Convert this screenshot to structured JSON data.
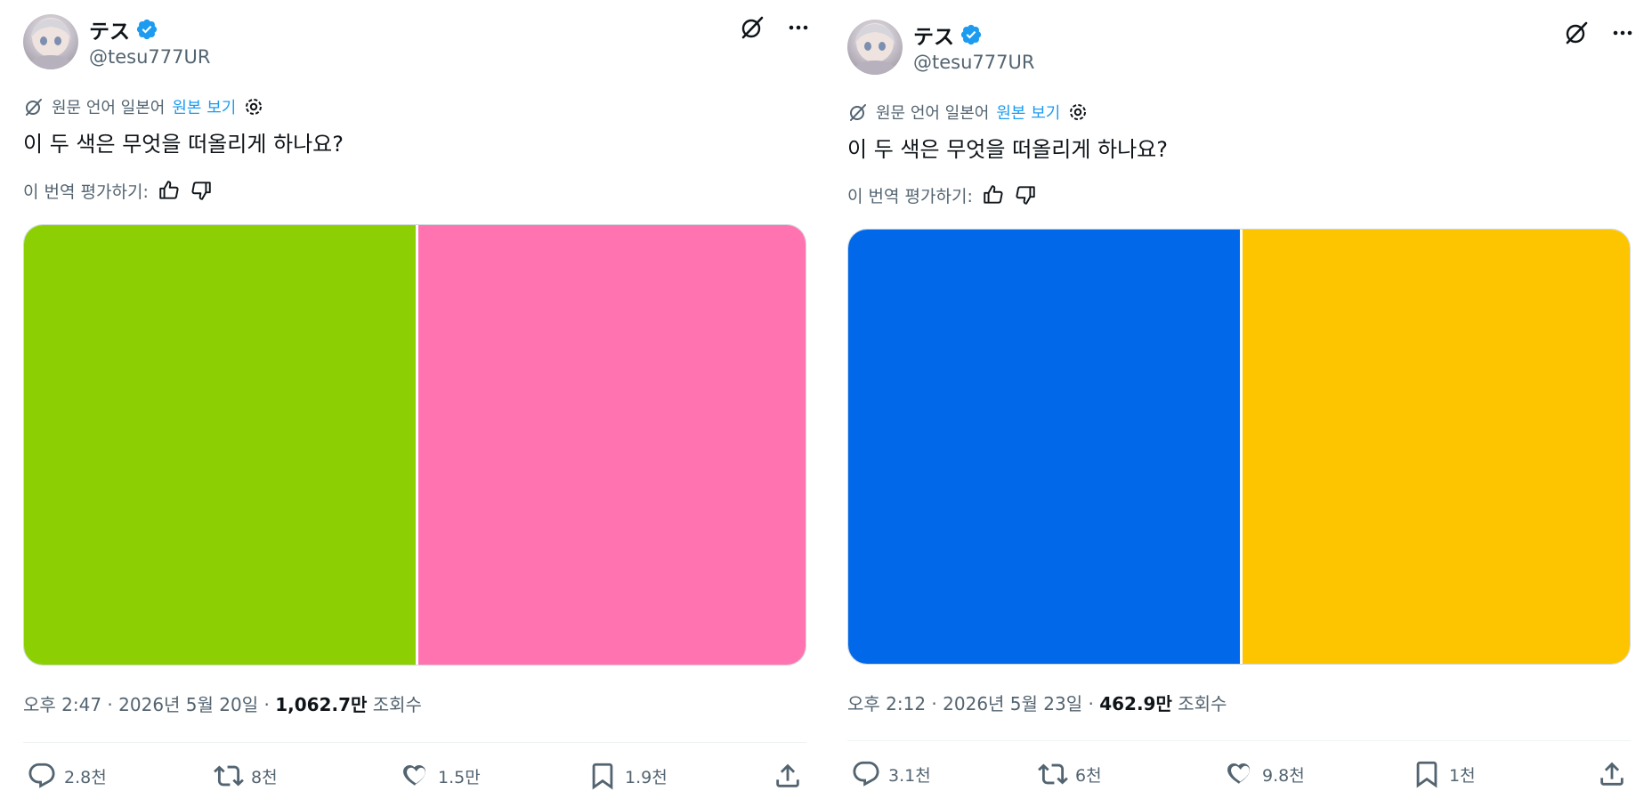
{
  "tweets": [
    {
      "author": {
        "display_name": "テス",
        "handle": "@tesu777UR"
      },
      "translation": {
        "source_note": "원문 언어 일본어",
        "show_original": "원본 보기",
        "rate_prompt": "이 번역 평가하기:"
      },
      "text": "이 두 색은 무엇을 떠올리게 하나요?",
      "media": {
        "left_color": "#8cd003",
        "right_color": "#ff73b0"
      },
      "meta": {
        "timestamp": "오후 2:47 · 2026년 5월 20일 · ",
        "views_count": "1,062.7만",
        "views_label": " 조회수"
      },
      "actions": {
        "replies": "2.8천",
        "retweets": "8천",
        "likes": "1.5만",
        "bookmarks": "1.9천"
      }
    },
    {
      "author": {
        "display_name": "テス",
        "handle": "@tesu777UR"
      },
      "translation": {
        "source_note": "원문 언어 일본어",
        "show_original": "원본 보기",
        "rate_prompt": "이 번역 평가하기:"
      },
      "text": "이 두 색은 무엇을 떠올리게 하나요?",
      "media": {
        "left_color": "#0169e9",
        "right_color": "#fdc500"
      },
      "meta": {
        "timestamp": "오후 2:12 · 2026년 5월 23일 · ",
        "views_count": "462.9만",
        "views_label": " 조회수"
      },
      "actions": {
        "replies": "3.1천",
        "retweets": "6천",
        "likes": "9.8천",
        "bookmarks": "1천"
      }
    }
  ],
  "theme": {
    "text_primary": "#0f1419",
    "text_secondary": "#536471",
    "link": "#1d9bf0",
    "verified": "#1d9bf0",
    "border": "#cfd9de"
  },
  "icons": [
    "avatar",
    "verified-badge-icon",
    "grok-icon",
    "more-icon",
    "translate-icon",
    "settings-icon",
    "thumbs-up-icon",
    "thumbs-down-icon",
    "reply-icon",
    "retweet-icon",
    "like-icon",
    "bookmark-icon",
    "share-icon"
  ]
}
